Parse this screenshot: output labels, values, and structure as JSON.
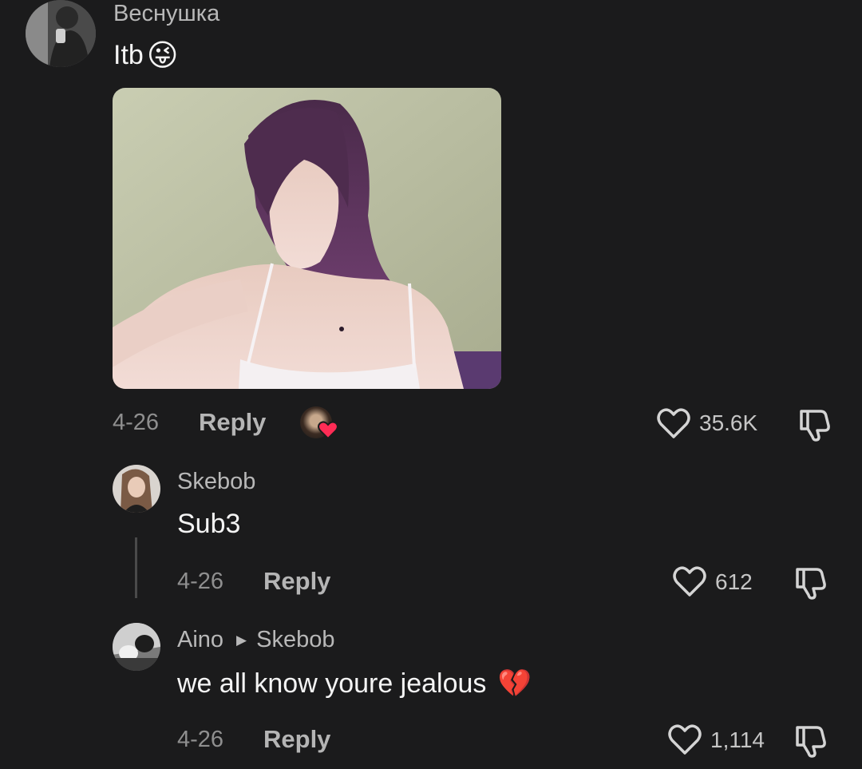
{
  "colors": {
    "background": "#1b1b1c",
    "name_text": "#b8b8b8",
    "body_text": "#f4f4f4",
    "meta_text": "#8f8f8f",
    "heart_red": "#fe2c55"
  },
  "comment": {
    "username": "Веснушка",
    "text": "Itb",
    "emoji": "😜",
    "date": "4-26",
    "reply_label": "Reply",
    "likes": "35.6K"
  },
  "replies": [
    {
      "username": "Skebob",
      "text": "Sub3",
      "date": "4-26",
      "reply_label": "Reply",
      "likes": "612"
    },
    {
      "username": "Aino",
      "reply_to": "Skebob",
      "text": "we all know youre jealous",
      "emoji": "💔",
      "date": "4-26",
      "reply_label": "Reply",
      "likes": "1,114"
    }
  ]
}
